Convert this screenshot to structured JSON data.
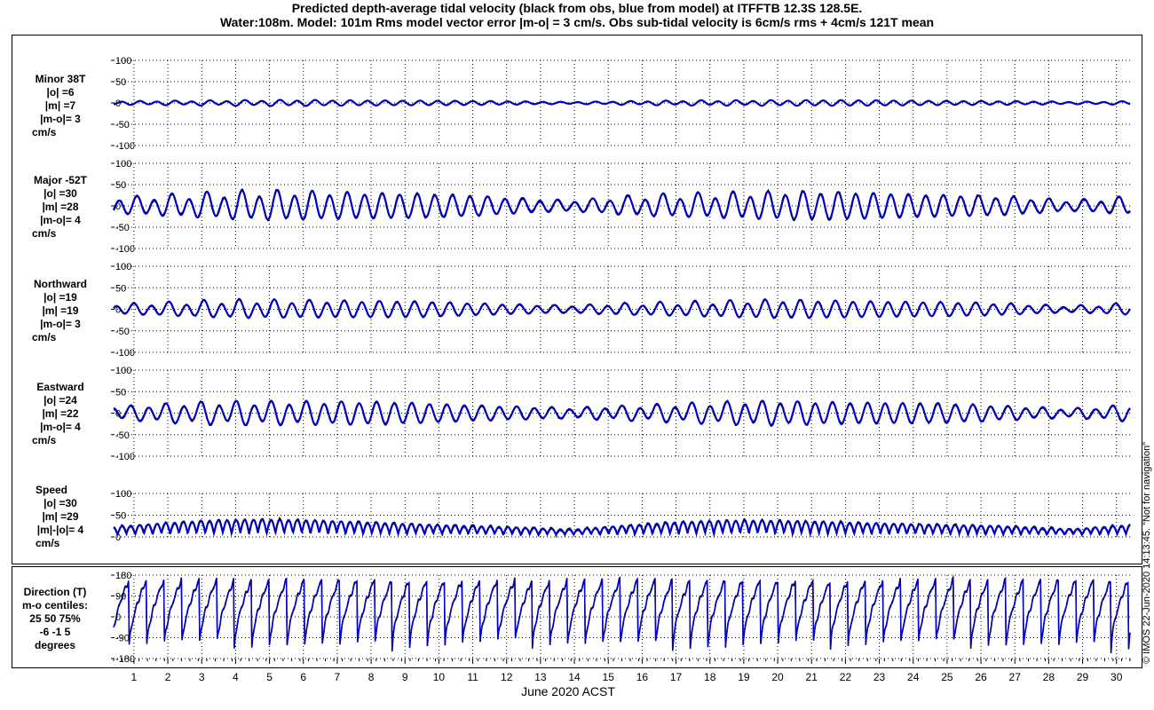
{
  "title": {
    "line1": "Predicted depth-average tidal velocity (black from obs, blue from model) at ITFFTB 12.3S 128.5E.",
    "line2": "Water:108m. Model: 101m  Rms model vector error |m-o| = 3 cm/s. Obs sub-tidal velocity is 6cm/s rms + 4cm/s 121T mean"
  },
  "xlabel": "June 2020 ACST",
  "copyright": "© IMOS 22-Jun-2020 14:13:45. \"Not for navigation\"",
  "colors": {
    "obs": "#000000",
    "model": "#0000cc",
    "grid": "#000000"
  },
  "panels": [
    {
      "id": "minor",
      "labels": [
        "Minor 38T",
        "|o| =6",
        "|m| =7",
        "|m-o|= 3",
        "cm/s"
      ],
      "ylim": [
        -100,
        100
      ],
      "yticks": [
        "100",
        "50",
        "0",
        "-50",
        "-100"
      ],
      "amplitude": 8
    },
    {
      "id": "major",
      "labels": [
        "Major -52T",
        "|o| =30",
        "|m| =28",
        "|m-o|= 4",
        "cm/s"
      ],
      "ylim": [
        -100,
        100
      ],
      "yticks": [
        "100",
        "50",
        "0",
        "-50",
        "-100"
      ],
      "amplitude": 40
    },
    {
      "id": "northward",
      "labels": [
        "Northward",
        "|o| =19",
        "|m| =19",
        "|m-o|= 3",
        "cm/s"
      ],
      "ylim": [
        -100,
        100
      ],
      "yticks": [
        "100",
        "50",
        "0",
        "-50",
        "-100"
      ],
      "amplitude": 25
    },
    {
      "id": "eastward",
      "labels": [
        "Eastward",
        "|o| =24",
        "|m| =22",
        "|m-o|= 4",
        "cm/s"
      ],
      "ylim": [
        -100,
        100
      ],
      "yticks": [
        "100",
        "50",
        "0",
        "-50",
        "-100"
      ],
      "amplitude": 33
    },
    {
      "id": "speed",
      "labels": [
        "Speed",
        "|o| =30",
        "|m| =29",
        "|m|-|o|= 4",
        "cm/s"
      ],
      "ylim": [
        0,
        100
      ],
      "yticks": [
        "100",
        "50",
        "0"
      ],
      "amplitude": 40
    },
    {
      "id": "direction",
      "labels": [
        "Direction (T)",
        "m-o centiles:",
        "25  50  75%",
        "-6 -1  5",
        "degrees"
      ],
      "ylim": [
        -180,
        180
      ],
      "yticks": [
        "180",
        "90",
        "0",
        "-90",
        "-180"
      ]
    }
  ],
  "chart_data": {
    "type": "line",
    "title": "Predicted depth-average tidal velocity (black from obs, blue from model) at ITFFTB 12.3S 128.5E.",
    "xlabel": "June 2020 ACST",
    "x_days": [
      "1",
      "2",
      "3",
      "4",
      "5",
      "6",
      "7",
      "8",
      "9",
      "10",
      "11",
      "12",
      "13",
      "14",
      "15",
      "16",
      "17",
      "18",
      "19",
      "20",
      "21",
      "22",
      "23",
      "24",
      "25",
      "26",
      "27",
      "28",
      "29",
      "30"
    ],
    "xlim": [
      0.4,
      30.4
    ],
    "grid": true,
    "series": [
      {
        "name": "obs",
        "color": "#000000"
      },
      {
        "name": "model",
        "color": "#0000cc"
      }
    ],
    "stats": {
      "minor_38T": {
        "o": 6,
        "m": 7,
        "m_minus_o": 3
      },
      "major_-52T": {
        "o": 30,
        "m": 28,
        "m_minus_o": 4
      },
      "northward": {
        "o": 19,
        "m": 19,
        "m_minus_o": 3
      },
      "eastward": {
        "o": 24,
        "m": 22,
        "m_minus_o": 4
      },
      "speed": {
        "o": 30,
        "m": 29,
        "abs_m_minus_abs_o": 4
      },
      "direction_centiles_m_minus_o": {
        "p25": -6,
        "p50": -1,
        "p75": 5
      }
    }
  }
}
